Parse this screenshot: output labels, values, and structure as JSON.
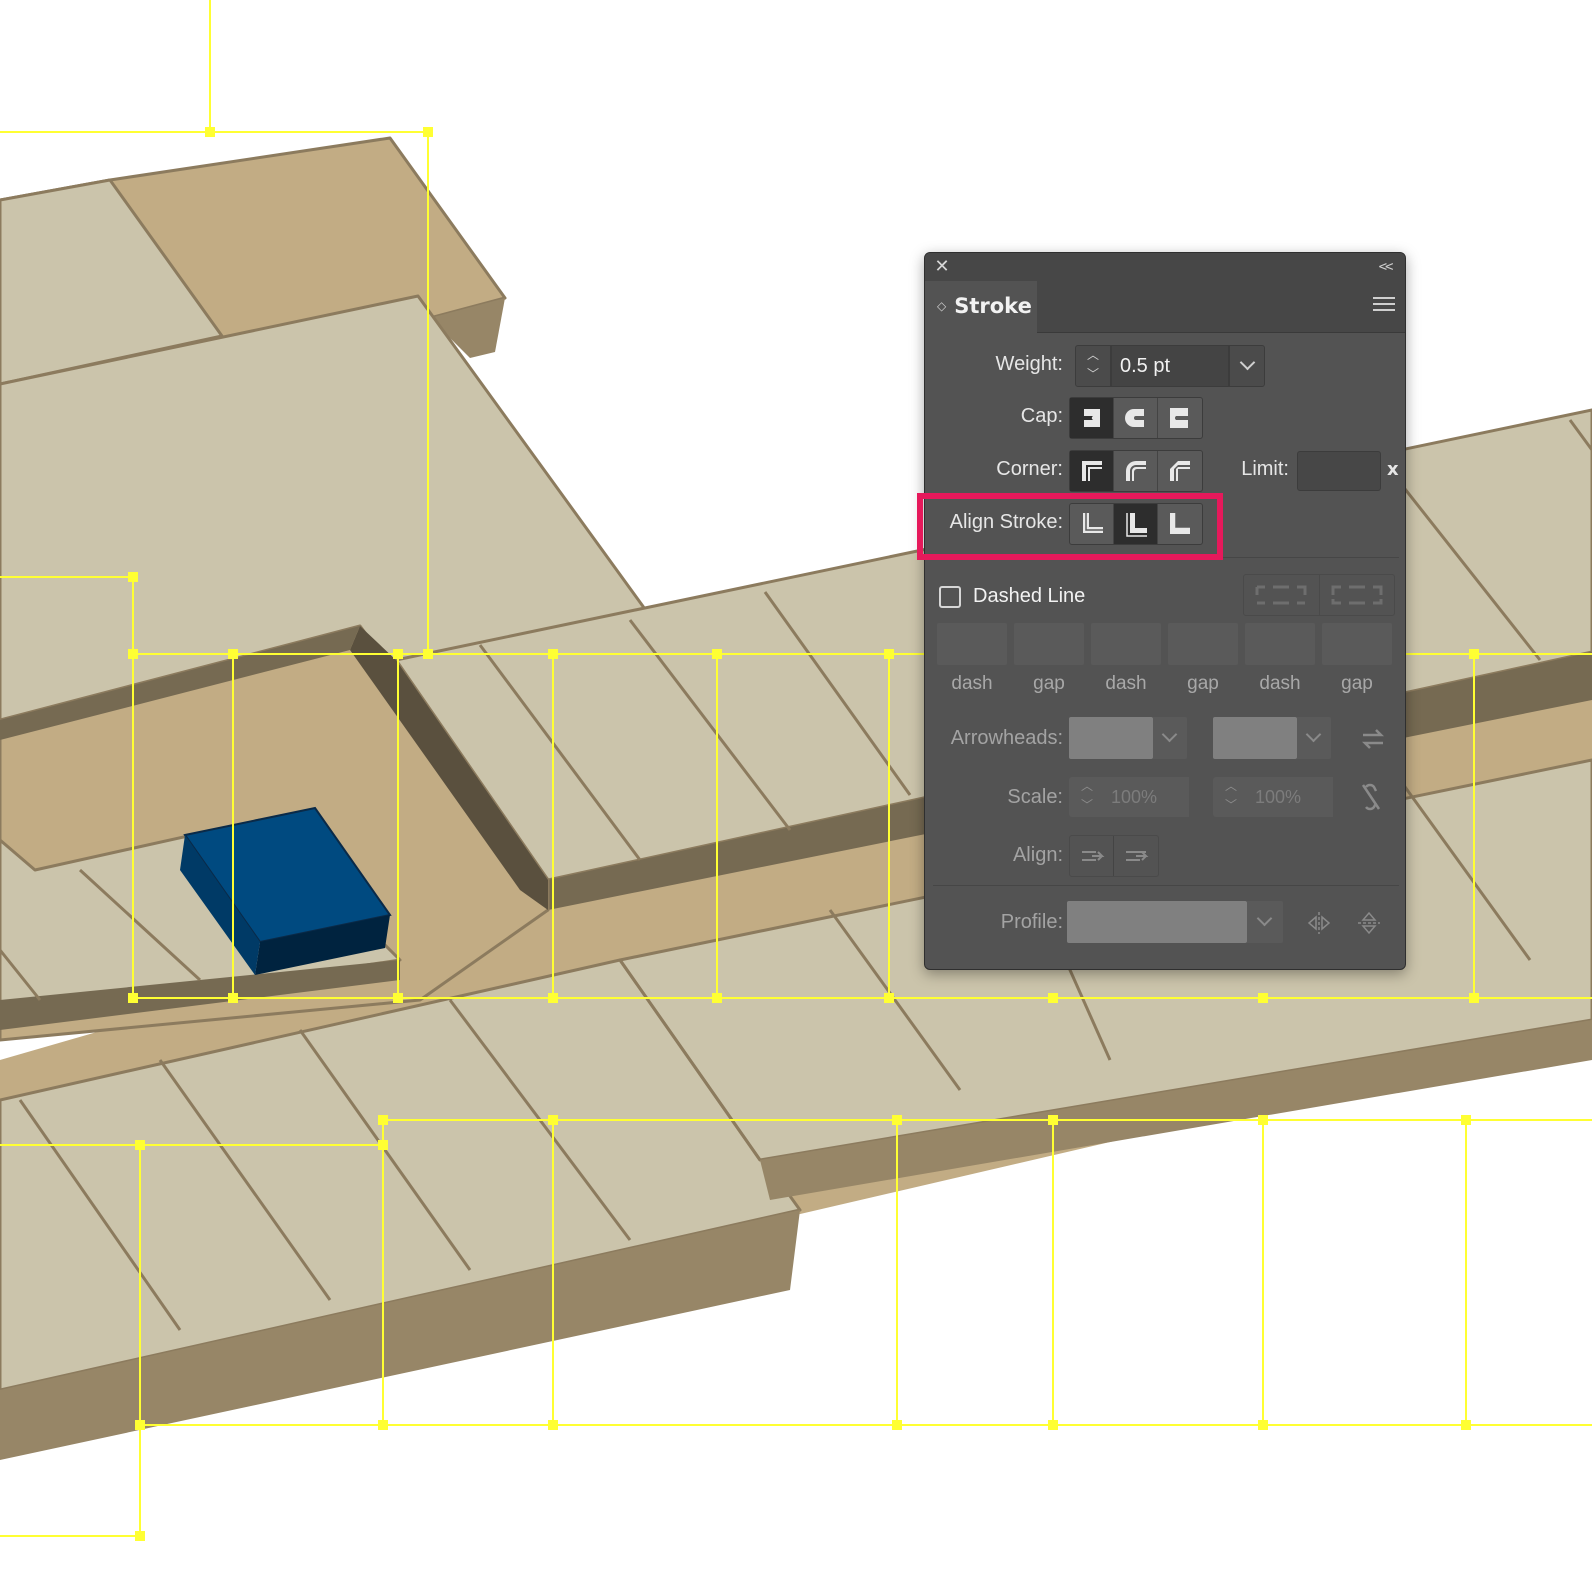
{
  "panel": {
    "tab_title": "Stroke",
    "close_symbol": "✕",
    "collapse_symbol": "<<",
    "weight": {
      "label": "Weight:",
      "value": "0.5 pt"
    },
    "cap": {
      "label": "Cap:",
      "selected": "butt",
      "options": [
        "butt-cap-icon",
        "round-cap-icon",
        "projecting-cap-icon"
      ]
    },
    "corner": {
      "label": "Corner:",
      "selected": "miter",
      "options": [
        "miter-join-icon",
        "round-join-icon",
        "bevel-join-icon"
      ]
    },
    "limit": {
      "label": "Limit:",
      "value": "",
      "suffix": "x"
    },
    "align_stroke": {
      "label": "Align Stroke:",
      "selected": "inside",
      "options": [
        "align-center-icon",
        "align-inside-icon",
        "align-outside-icon"
      ]
    },
    "dashed_line": {
      "label": "Dashed Line",
      "checked": false
    },
    "dash_fields": [
      "dash",
      "gap",
      "dash",
      "gap",
      "dash",
      "gap"
    ],
    "arrowheads": {
      "label": "Arrowheads:"
    },
    "scale": {
      "label": "Scale:",
      "start": "100%",
      "end": "100%"
    },
    "align": {
      "label": "Align:"
    },
    "profile": {
      "label": "Profile:"
    }
  },
  "colors": {
    "highlight": "#e6195b",
    "guides": "#ffff33",
    "selected_object": "#004a80"
  }
}
